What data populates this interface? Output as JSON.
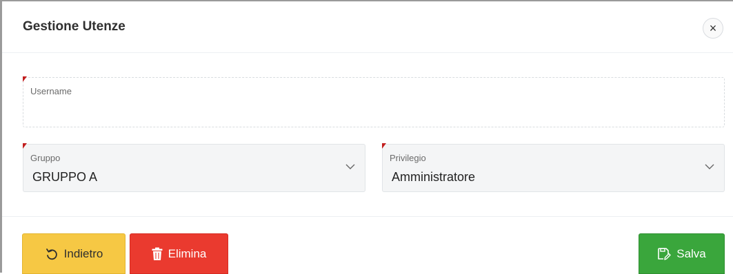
{
  "modal": {
    "title": "Gestione Utenze",
    "close_glyph": "×"
  },
  "form": {
    "username": {
      "label": "Username",
      "value": ""
    },
    "gruppo": {
      "label": "Gruppo",
      "value": "GRUPPO A"
    },
    "privilegio": {
      "label": "Privilegio",
      "value": "Amministratore"
    }
  },
  "buttons": {
    "back_label": "Indietro",
    "delete_label": "Elimina",
    "save_label": "Salva"
  },
  "colors": {
    "back": "#f6c844",
    "delete": "#ea3a2f",
    "save": "#3aa63c",
    "required_marker": "#c21f1f"
  },
  "icons": [
    "close-icon",
    "undo-icon",
    "trash-icon",
    "save-icon",
    "chevron-down-icon"
  ]
}
